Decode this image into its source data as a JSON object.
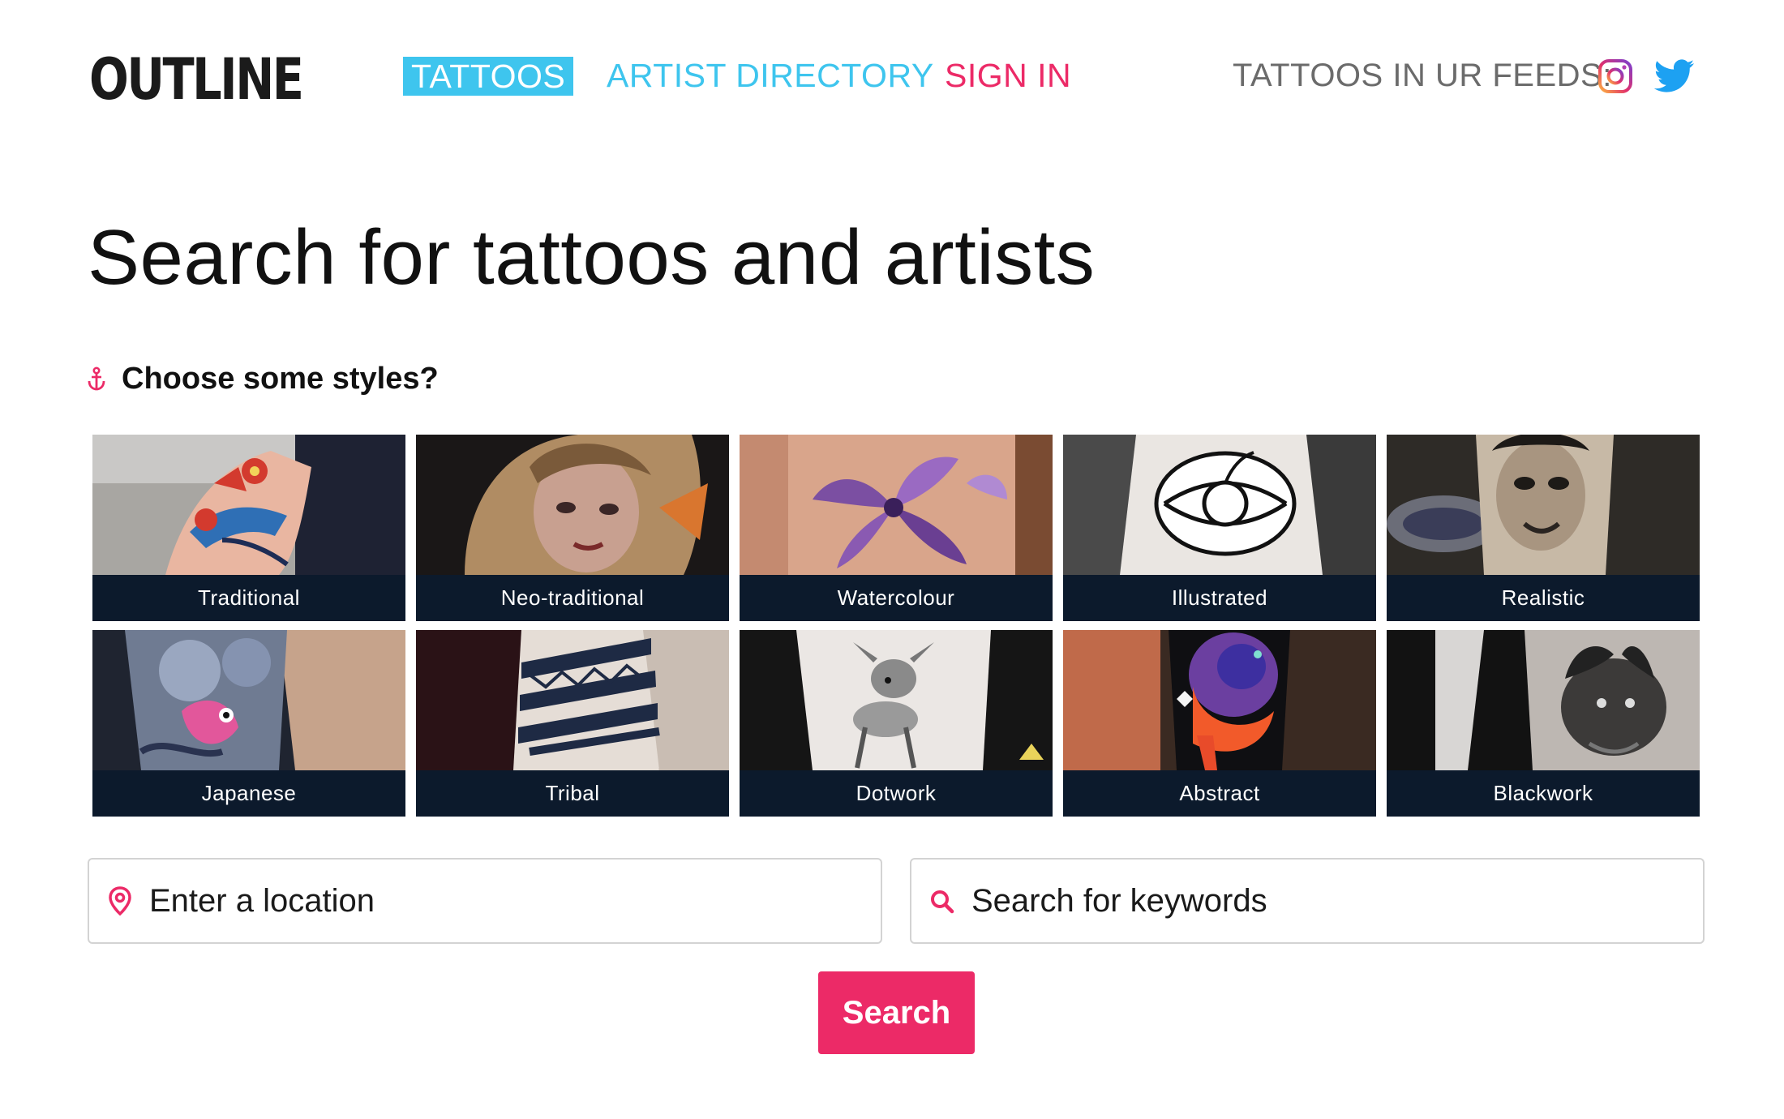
{
  "brand": {
    "logo": "OUTLINE"
  },
  "nav": {
    "tattoos": "TATTOOS",
    "artist_directory": "ARTIST DIRECTORY",
    "sign_in": "SIGN IN",
    "feeds_label": "TATTOOS IN UR FEEDS:",
    "social_icons": [
      "instagram-icon",
      "twitter-icon"
    ]
  },
  "page": {
    "title": "Search for tattoos and artists",
    "styles_heading": "Choose some styles?"
  },
  "styles": [
    {
      "label": "Traditional"
    },
    {
      "label": "Neo-traditional"
    },
    {
      "label": "Watercolour"
    },
    {
      "label": "Illustrated"
    },
    {
      "label": "Realistic"
    },
    {
      "label": "Japanese"
    },
    {
      "label": "Tribal"
    },
    {
      "label": "Dotwork"
    },
    {
      "label": "Abstract"
    },
    {
      "label": "Blackwork"
    }
  ],
  "search": {
    "location_placeholder": "Enter a location",
    "keywords_placeholder": "Search for keywords",
    "button_label": "Search"
  },
  "colors": {
    "accent_pink": "#ec2a67",
    "accent_blue": "#3ec5ee",
    "tile_label_bg": "#0c1a2c"
  }
}
